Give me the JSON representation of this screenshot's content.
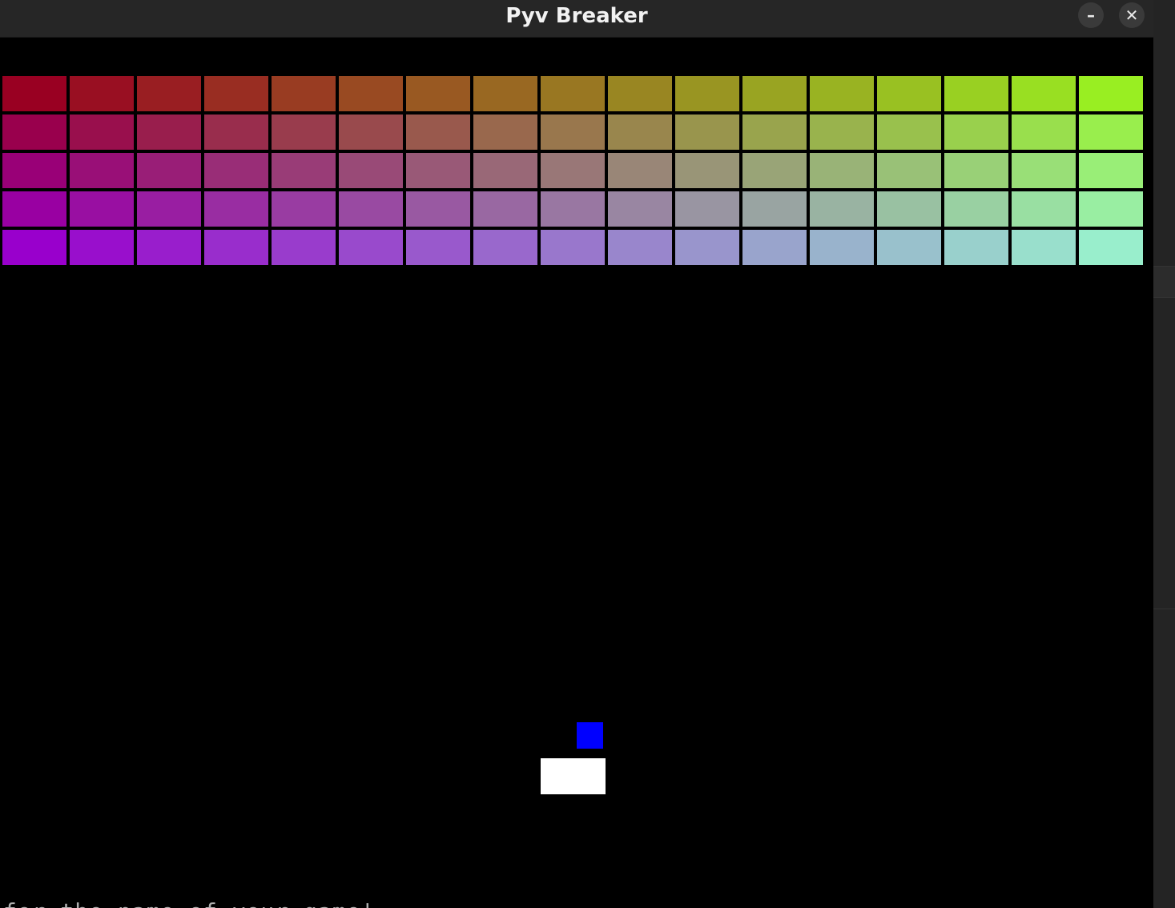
{
  "window": {
    "title": "Pyv Breaker",
    "minimize_label": "–",
    "close_label": "✕"
  },
  "game": {
    "background": "#000000",
    "bricks": {
      "rows": 5,
      "cols": 17,
      "color_top_left": "#990022",
      "color_top_right": "#99ee22",
      "color_bottom_left": "#9900cc",
      "color_bottom_right": "#99eecc"
    },
    "ball_color": "#0000ff",
    "paddle_color": "#ffffff"
  },
  "background_terminal": {
    "text": "for the name of your game'"
  }
}
